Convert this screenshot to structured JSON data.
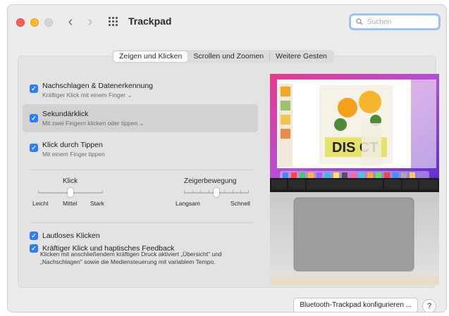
{
  "window": {
    "title": "Trackpad"
  },
  "search": {
    "placeholder": "Suchen",
    "value": ""
  },
  "tabs": [
    {
      "label": "Zeigen und Klicken",
      "active": true
    },
    {
      "label": "Scrollen und Zoomen",
      "active": false
    },
    {
      "label": "Weitere Gesten",
      "active": false
    }
  ],
  "options": [
    {
      "title": "Nachschlagen & Datenerkennung",
      "subtitle": "Kräftiger Klick mit einem Finger ⌄",
      "checked": true
    },
    {
      "title": "Sekundärklick",
      "subtitle": "Mit zwei Fingern klicken oder tippen ⌄",
      "checked": true
    },
    {
      "title": "Klick durch Tippen",
      "subtitle": "Mit einem Finger tippen",
      "checked": true
    }
  ],
  "sliders": {
    "click": {
      "label": "Klick",
      "min_label": "Leicht",
      "mid_label": "Mittel",
      "max_label": "Stark",
      "value": 0.5
    },
    "pointer": {
      "label": "Zeigerbewegung",
      "min_label": "Langsam",
      "max_label": "Schnell",
      "value": 0.5
    }
  },
  "bottom_options": [
    {
      "title": "Lautloses Klicken",
      "checked": true
    },
    {
      "title": "Kräftiger Klick und haptisches Feedback",
      "checked": true
    }
  ],
  "feedback_description": "Klicken mit anschließendem kräftigen Druck aktiviert „Übersicht\" und „Nachschlagen\" sowie die Mediensteuerung mit variablem Tempo.",
  "preview": {
    "slide_text": "DIS   CT"
  },
  "footer": {
    "config_button": "Bluetooth-Trackpad konfigurieren ...",
    "help": "?"
  },
  "colors": {
    "accent": "#2f7cf6",
    "search_focus": "#9cc2f5"
  }
}
